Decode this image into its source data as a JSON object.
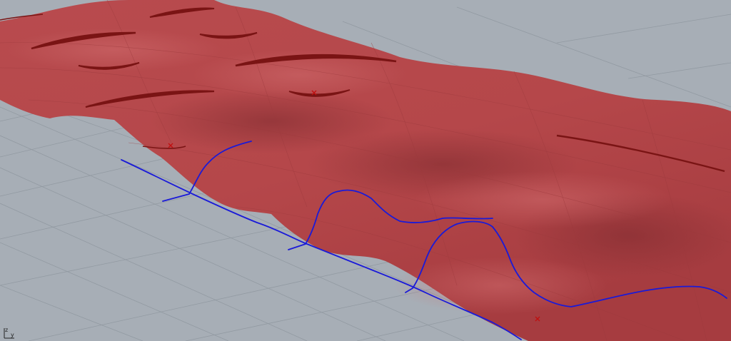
{
  "viewport": {
    "background_color": "#a7aeb6",
    "grid_color": "#8b939b",
    "surface_color": "#b14649",
    "surface_shade_color": "#8a2f33",
    "crease_color": "#7a1414",
    "curve_color": "#1a1ad8",
    "control_point_color": "#c01010",
    "axis_indicator": {
      "z_label": "z",
      "y_label": "y"
    }
  }
}
